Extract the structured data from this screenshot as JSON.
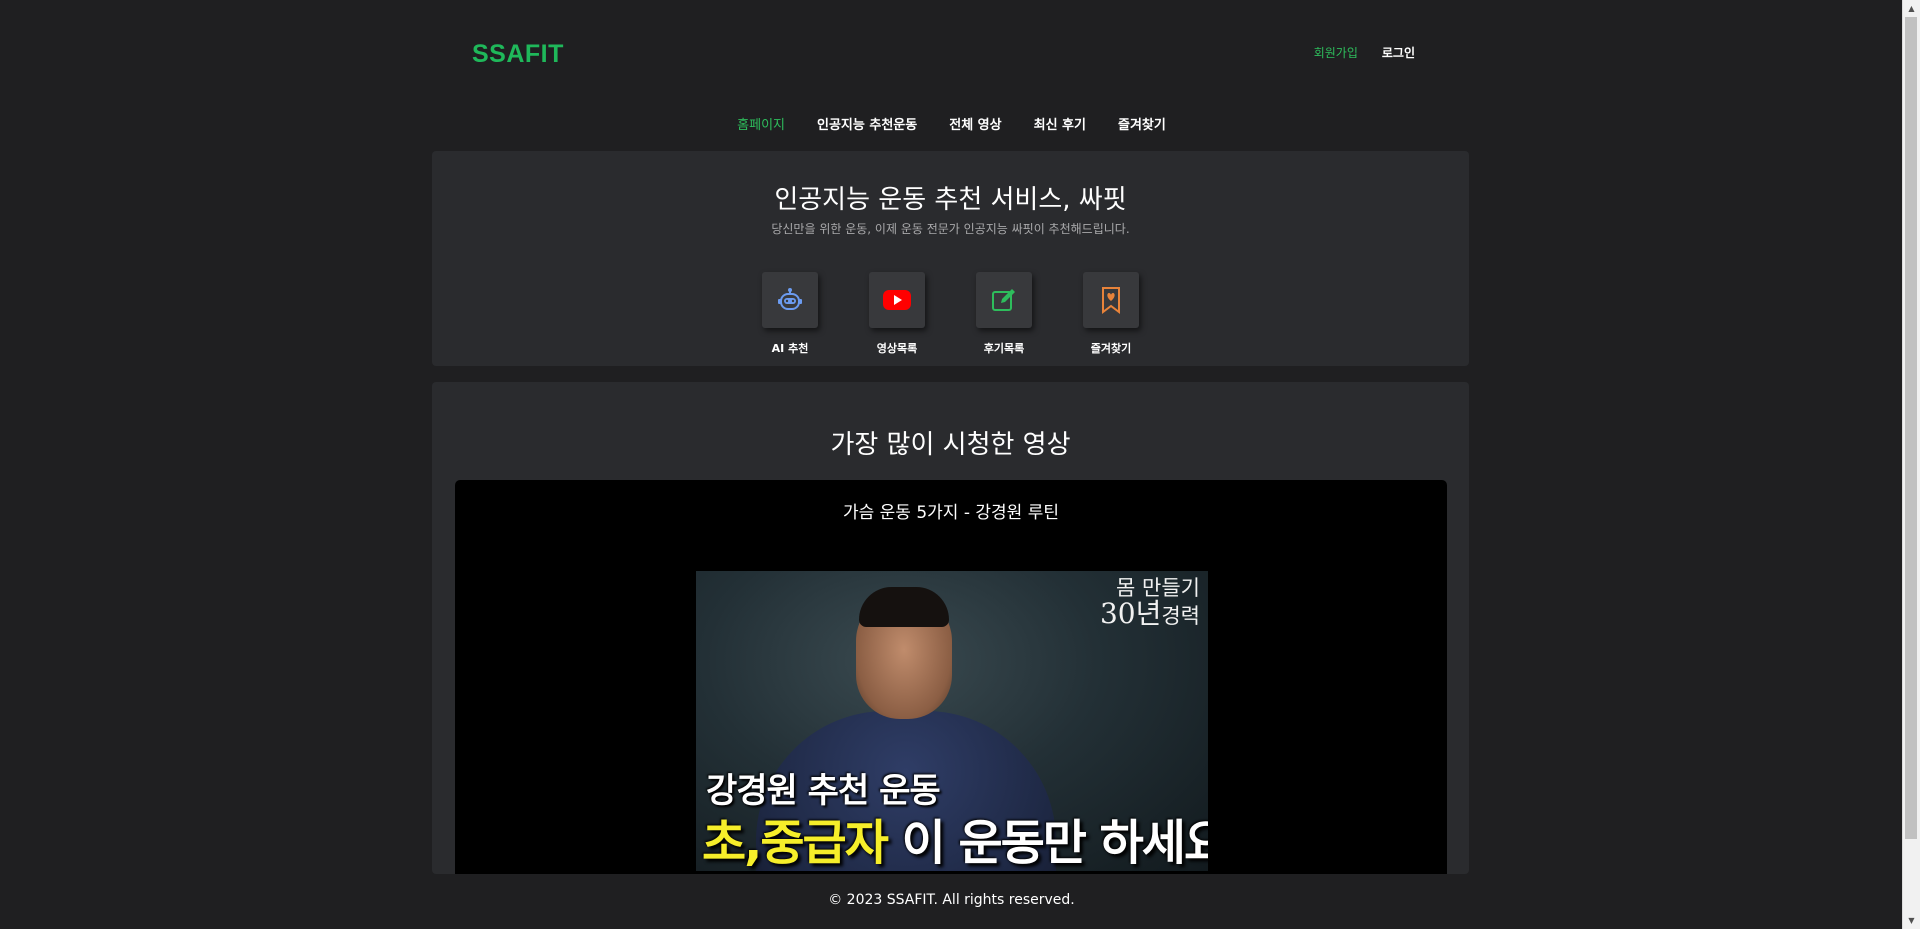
{
  "header": {
    "logo": "SSAFIT",
    "signup": "회원가입",
    "login": "로그인"
  },
  "nav": {
    "items": [
      "홈페이지",
      "인공지능 추천운동",
      "전체 영상",
      "최신 후기",
      "즐겨찾기"
    ],
    "active_index": 0
  },
  "hero": {
    "title": "인공지능 운동 추천 서비스, 싸핏",
    "subtitle": "당신만을 위한 운동, 이제 운동 전문가 인공지능 싸핏이 추천해드립니다.",
    "features": [
      {
        "label": "AI 추천",
        "icon": "robot-icon",
        "color": "#5b8def"
      },
      {
        "label": "영상목록",
        "icon": "youtube-icon",
        "color": "#ff0000"
      },
      {
        "label": "후기목록",
        "icon": "edit-icon",
        "color": "#2ebd5c"
      },
      {
        "label": "즐겨찾기",
        "icon": "bookmark-heart-icon",
        "color": "#e8833a"
      }
    ]
  },
  "popular": {
    "title": "가장 많이 시청한 영상",
    "video": {
      "title": "가슴 운동 5가지 - 강경원 루틴",
      "thumb_line1": "몸 만들기",
      "thumb_line2_num": "30년",
      "thumb_line2_rest": "경력",
      "thumb_caption1": "강경원 추천 운동",
      "thumb_caption2_highlight": "초,중급자",
      "thumb_caption2_rest": " 이 운동만 하세요"
    }
  },
  "footer": {
    "text": "© 2023 SSAFIT. All rights reserved."
  },
  "colors": {
    "accent": "#2ebd5c",
    "background": "#1f1f21",
    "panel": "#2a2b2e"
  }
}
